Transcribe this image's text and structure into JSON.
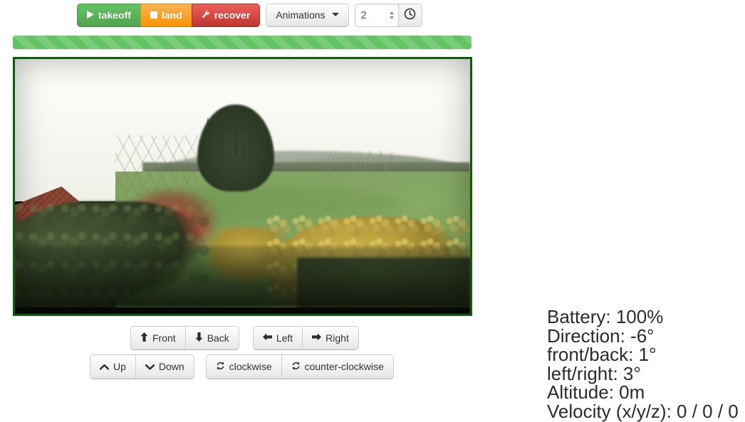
{
  "toolbar": {
    "flight_actions": [
      {
        "label": "takeoff",
        "icon": "play-icon",
        "style": "success"
      },
      {
        "label": "land",
        "icon": "stop-icon",
        "style": "warning"
      },
      {
        "label": "recover",
        "icon": "wrench-icon",
        "style": "danger"
      }
    ],
    "animations_label": "Animations",
    "animation_count": "2",
    "animation_count_placeholder": "",
    "clock_icon": "clock-icon",
    "caret_icon": "chevron-down-icon"
  },
  "progress": {
    "label": "",
    "percent": 100,
    "bar_color": "#62c462",
    "stripe_color": "#5cb85c"
  },
  "video": {
    "border_color": "#0d5d0d",
    "scene_description": "Drone camera feed: rural autumn landscape with house roof, pine tree, golden bushes and green meadow"
  },
  "controls": {
    "translate_group": [
      {
        "label": "Front",
        "icon": "arrow-up-icon",
        "glyph": "⬆"
      },
      {
        "label": "Back",
        "icon": "arrow-down-icon",
        "glyph": "⬇"
      }
    ],
    "strafe_group": [
      {
        "label": "Left",
        "icon": "arrow-left-icon",
        "glyph": "⬅"
      },
      {
        "label": "Right",
        "icon": "arrow-right-icon",
        "glyph": "➡"
      }
    ],
    "altitude_group": [
      {
        "label": "Up",
        "icon": "chevron-up-icon",
        "glyph": "⌃"
      },
      {
        "label": "Down",
        "icon": "chevron-down-icon",
        "glyph": "⌄"
      }
    ],
    "rotate_group": [
      {
        "label": "clockwise",
        "icon": "refresh-cw-icon",
        "glyph": "↻"
      },
      {
        "label": "counter-clockwise",
        "icon": "refresh-ccw-icon",
        "glyph": "↻"
      }
    ]
  },
  "telemetry": {
    "battery": "Battery: 100%",
    "direction": "Direction: -6°",
    "front_back": "front/back: 1°",
    "left_right": "left/right: 3°",
    "altitude": "Altitude: 0m",
    "velocity": "Velocity (x/y/z): 0 / 0 / 0"
  }
}
